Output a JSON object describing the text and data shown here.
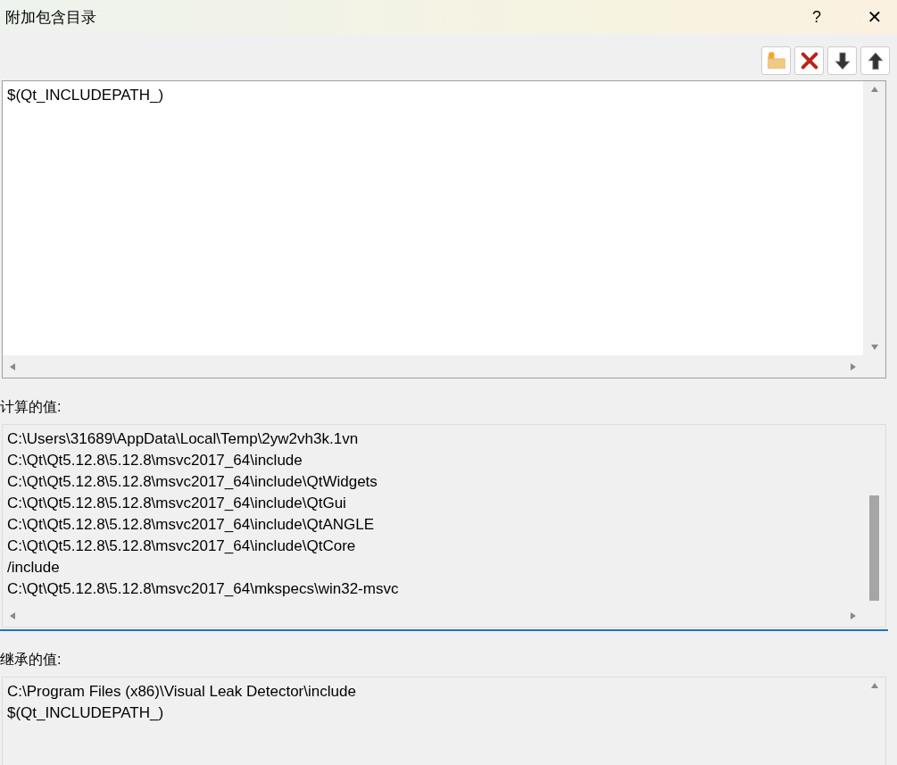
{
  "window": {
    "title": "附加包含目录",
    "help": "?",
    "close": "✕"
  },
  "toolbar": [
    {
      "kind": "new-folder"
    },
    {
      "kind": "delete"
    },
    {
      "kind": "move-down"
    },
    {
      "kind": "move-up"
    }
  ],
  "editor": {
    "lines": [
      "$(Qt_INCLUDEPATH_)"
    ]
  },
  "computed": {
    "label": "计算的值:",
    "lines": [
      "C:\\Users\\31689\\AppData\\Local\\Temp\\2yw2vh3k.1vn",
      "C:\\Qt\\Qt5.12.8\\5.12.8\\msvc2017_64\\include",
      "C:\\Qt\\Qt5.12.8\\5.12.8\\msvc2017_64\\include\\QtWidgets",
      "C:\\Qt\\Qt5.12.8\\5.12.8\\msvc2017_64\\include\\QtGui",
      "C:\\Qt\\Qt5.12.8\\5.12.8\\msvc2017_64\\include\\QtANGLE",
      "C:\\Qt\\Qt5.12.8\\5.12.8\\msvc2017_64\\include\\QtCore",
      "/include",
      "C:\\Qt\\Qt5.12.8\\5.12.8\\msvc2017_64\\mkspecs\\win32-msvc"
    ]
  },
  "inherited": {
    "label": "继承的值:",
    "lines": [
      "C:\\Program Files (x86)\\Visual Leak Detector\\include",
      "$(Qt_INCLUDEPATH_)"
    ]
  }
}
